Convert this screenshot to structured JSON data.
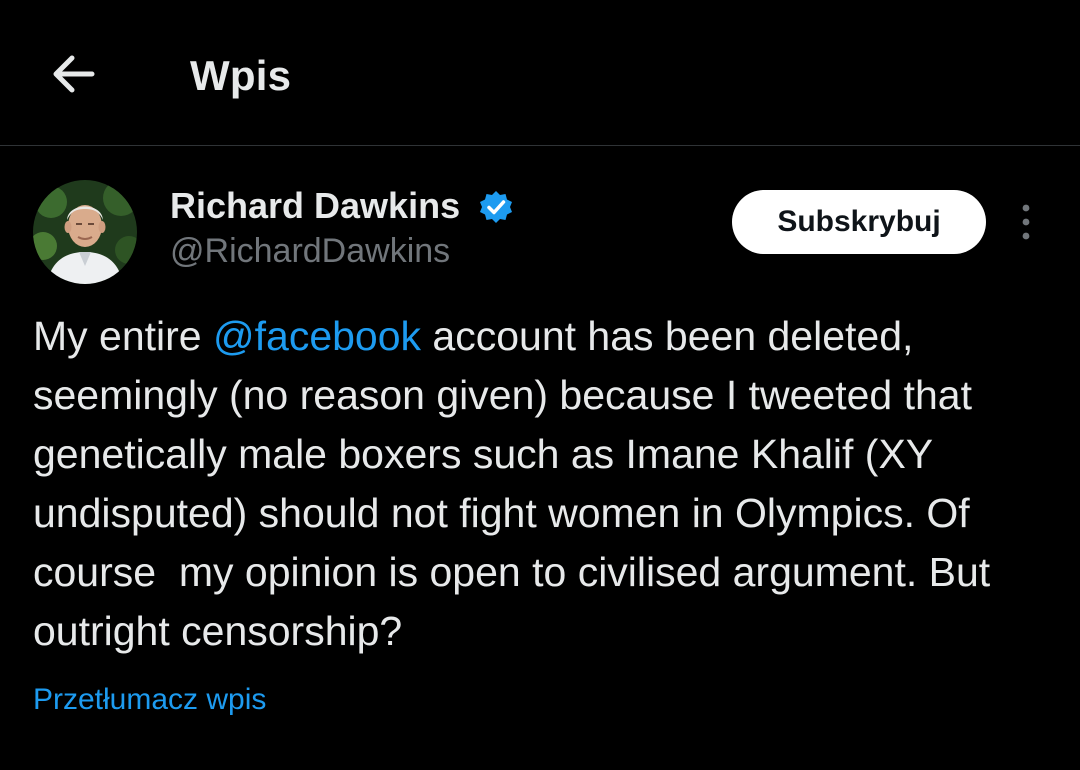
{
  "header": {
    "title": "Wpis",
    "back_icon": "arrow-left-icon"
  },
  "author": {
    "display_name": "Richard Dawkins",
    "handle": "@RichardDawkins",
    "verified": true,
    "verified_icon": "verified-badge-icon",
    "avatar": "avatar-photo"
  },
  "actions": {
    "subscribe_label": "Subskrybuj",
    "more_icon": "more-vertical-icon"
  },
  "tweet": {
    "text_before_mention": "My entire ",
    "mention": "@facebook",
    "text_after_mention": " account has been deleted, seemingly (no reason given) because I tweeted that genetically male boxers such as Imane Khalif (XY undisputed) should not fight women in Olympics. Of course  my opinion is open to civilised argument. But outright censorship?",
    "translate_label": "Przetłumacz wpis"
  },
  "colors": {
    "background": "#000000",
    "text": "#e7e9ea",
    "secondary_text": "#71767b",
    "accent": "#1d9bf0",
    "divider": "#2f3336",
    "button_bg": "#ffffff"
  }
}
